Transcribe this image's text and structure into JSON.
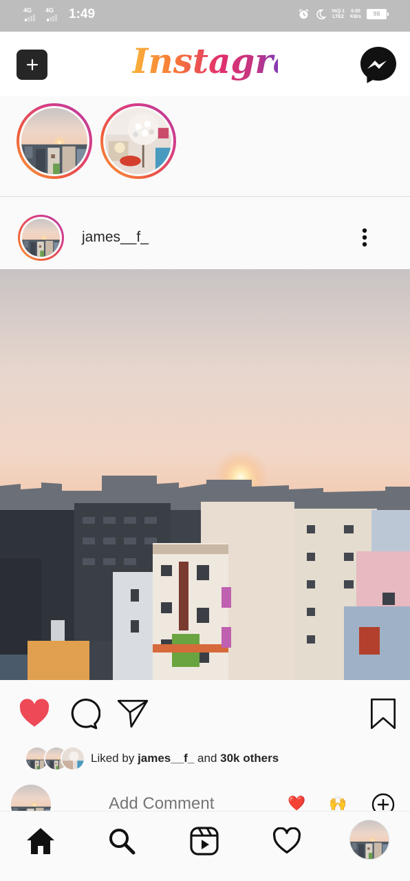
{
  "status_bar": {
    "sim1": "4G",
    "sim2": "4G",
    "time": "1:49",
    "volte": "Vo)) 1",
    "lte": "LTE2",
    "speed": "0.00",
    "speed_unit": "KB/s",
    "battery": "98",
    "icons": [
      "alarm-icon",
      "moon-icon"
    ]
  },
  "header": {
    "logo": "Instagram",
    "icons": [
      "plus-icon",
      "messenger-icon"
    ]
  },
  "stories": {
    "items": [
      {
        "name": "sunset-story"
      },
      {
        "name": "flowers-story"
      }
    ]
  },
  "post": {
    "username": "james__f_",
    "actions": [
      "heart-icon",
      "comment-icon",
      "send-icon",
      "bookmark-icon"
    ],
    "liked": true,
    "likes": {
      "prefix": "Liked by",
      "user": "james__f_",
      "middle": "and",
      "others": "30k others"
    },
    "comment": {
      "placeholder": "Add Comment",
      "quick_emojis": [
        "❤️",
        "🙌"
      ]
    }
  },
  "colors": {
    "like_red": "#ed4956",
    "text": "#262626",
    "muted": "#a8a8a8",
    "status_bar": "#bdbdbd"
  },
  "bottom_nav": {
    "items": [
      "home-icon",
      "search-icon",
      "reels-icon",
      "activity-icon",
      "profile-avatar"
    ]
  }
}
